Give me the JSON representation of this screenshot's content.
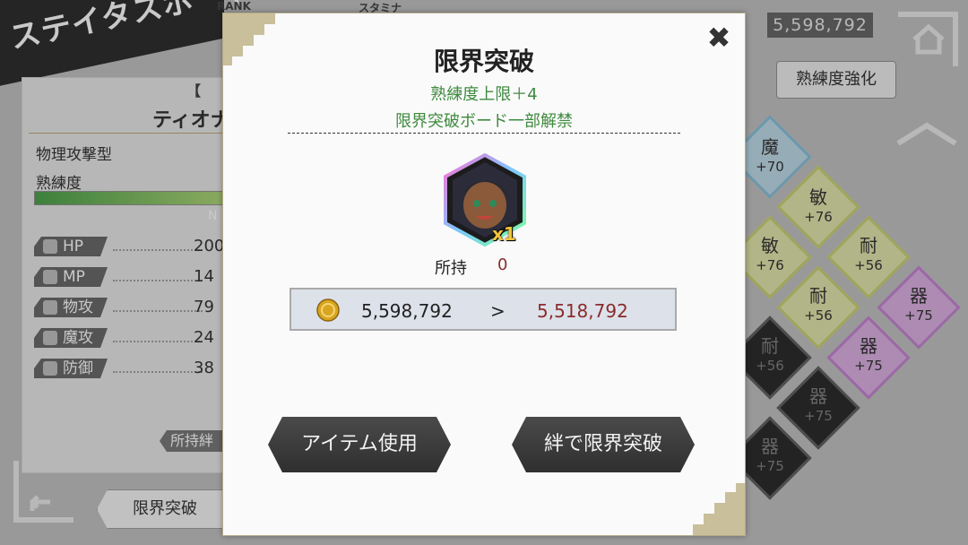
{
  "header": {
    "screen_title": "ステイタスボード",
    "rank_label": "RANK",
    "stamina_label": "スタミナ",
    "money": "5,598,792"
  },
  "left_panel": {
    "bracket": "【",
    "name": "ティオナ",
    "type": "物理攻撃型",
    "proficiency_label": "熟練度",
    "next_label": "N",
    "stats": [
      {
        "label": "HP",
        "value": "200",
        "icon": "heart-icon"
      },
      {
        "label": "MP",
        "value": "14",
        "icon": "mp-icon"
      },
      {
        "label": "物攻",
        "value": "79",
        "icon": "sword-icon"
      },
      {
        "label": "魔攻",
        "value": "24",
        "icon": "magic-icon"
      },
      {
        "label": "防御",
        "value": "38",
        "icon": "shield-icon"
      }
    ],
    "owned_bond": "所持絆"
  },
  "bottom": {
    "limit_break_tab": "限界突破"
  },
  "right_panel": {
    "mastery_button": "熟練度強化",
    "tiles": [
      {
        "kanji": "魔",
        "value": "+70"
      },
      {
        "kanji": "敏",
        "value": "+76"
      },
      {
        "kanji": "敏",
        "value": "+76"
      },
      {
        "kanji": "耐",
        "value": "+56"
      },
      {
        "kanji": "耐",
        "value": "+56"
      },
      {
        "kanji": "器",
        "value": "+75"
      },
      {
        "kanji": "器",
        "value": "+75"
      },
      {
        "kanji": "耐",
        "value": "+56"
      },
      {
        "kanji": "器",
        "value": "+75"
      },
      {
        "kanji": "器",
        "value": "+75"
      }
    ]
  },
  "modal": {
    "title": "限界突破",
    "subtitle1": "熟練度上限＋4",
    "subtitle2": "限界突破ボード一部解禁",
    "multiplier": "x1",
    "owned_label": "所持",
    "owned_value": "0",
    "coin_from": "5,598,792",
    "coin_arrow": ">",
    "coin_to": "5,518,792",
    "use_item_button": "アイテム使用",
    "bond_break_button": "絆で限界突破",
    "close": "✖"
  },
  "colors": {
    "accent_green": "#3f8a3f",
    "cost_red": "#8a2c2c",
    "button_dark": "#3a3a3a"
  }
}
